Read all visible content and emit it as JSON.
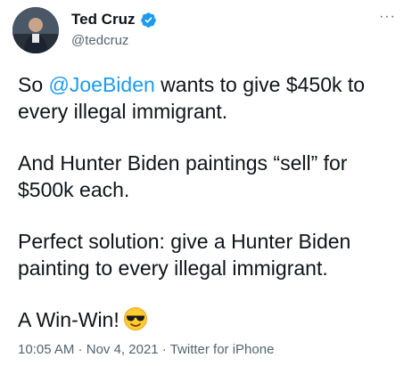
{
  "author": {
    "display_name": "Ted Cruz",
    "handle": "@tedcruz",
    "verified": true
  },
  "tweet": {
    "line1_prefix": "So ",
    "mention": "@JoeBiden",
    "line1_suffix": " wants to give $450k to every illegal immigrant.",
    "para2": "And Hunter Biden paintings “sell” for $500k each.",
    "para3": "Perfect solution: give a Hunter Biden painting to every illegal immigrant.",
    "para4": "A Win-Win!",
    "emoji": "smiling-face-with-sunglasses-icon"
  },
  "meta": {
    "time": "10:05 AM",
    "separator": " · ",
    "date": "Nov 4, 2021",
    "source": "Twitter for iPhone"
  },
  "menu": {
    "more_glyph": "···"
  },
  "colors": {
    "link": "#1d9bf0",
    "text": "#0f1419",
    "secondary": "#536471",
    "verified": "#1d9bf0"
  }
}
